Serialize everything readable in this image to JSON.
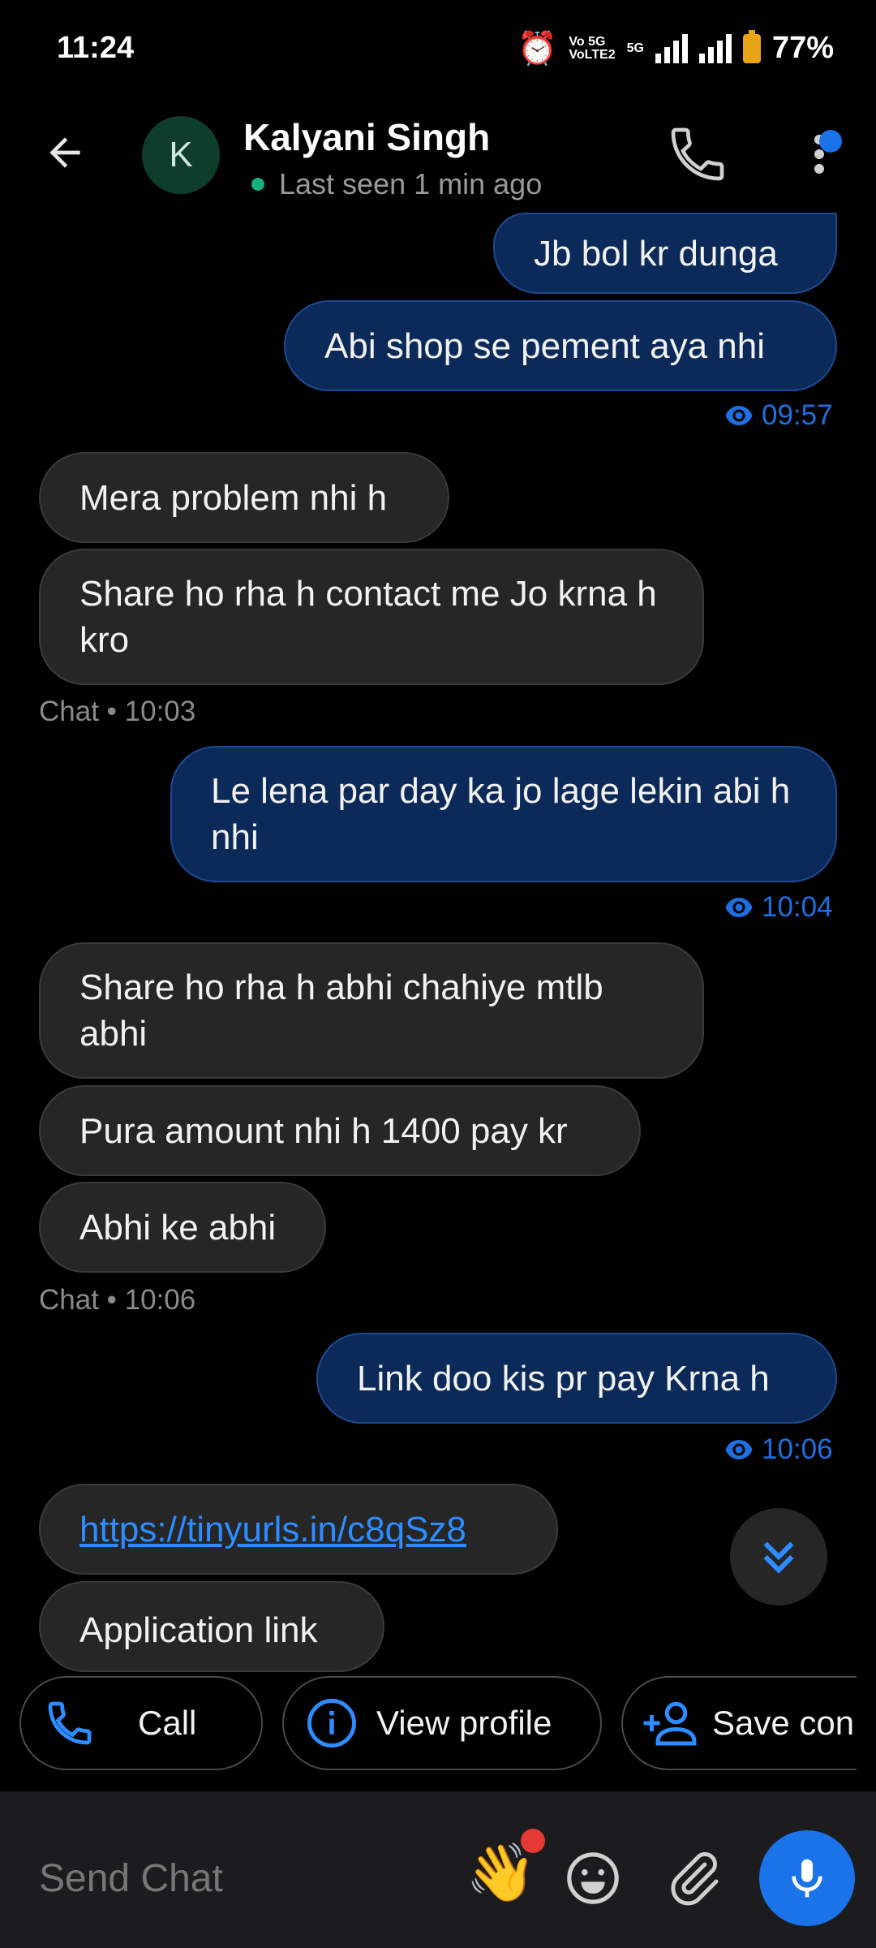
{
  "status_bar": {
    "time": "11:24",
    "net_top": "Vo 5G",
    "net_bottom": "VoLTE2",
    "net_5g": "5G",
    "battery": "77%"
  },
  "header": {
    "avatar_letter": "K",
    "name": "Kalyani Singh",
    "status": "Last seen 1 min ago"
  },
  "messages": [
    {
      "dir": "out",
      "text": "Jb bol kr dunga"
    },
    {
      "dir": "out",
      "text": "Abi shop se pement aya nhi"
    },
    {
      "seen_time": "09:57"
    },
    {
      "dir": "in",
      "text": "Mera problem nhi h"
    },
    {
      "dir": "in",
      "text": "Share ho rha h contact me Jo krna h kro"
    },
    {
      "meta": "Chat • 10:03"
    },
    {
      "dir": "out",
      "text": "Le lena par day ka jo lage lekin abi h nhi"
    },
    {
      "seen_time": "10:04"
    },
    {
      "dir": "in",
      "text": "Share ho rha h abhi chahiye mtlb abhi"
    },
    {
      "dir": "in",
      "text": "Pura amount nhi h 1400 pay kr"
    },
    {
      "dir": "in",
      "text": "Abhi ke abhi"
    },
    {
      "meta": "Chat • 10:06"
    },
    {
      "dir": "out",
      "text": "Link doo kis pr pay Krna h"
    },
    {
      "seen_time": "10:06"
    },
    {
      "dir": "in",
      "text": "https://tinyurls.in/c8qSz8"
    },
    {
      "dir": "in",
      "text": "Application link"
    }
  ],
  "chips": {
    "call": "Call",
    "view_profile": "View profile",
    "save_contact": "Save con"
  },
  "composer": {
    "placeholder": "Send Chat"
  },
  "colors": {
    "accent": "#1a73e8",
    "outgoing_bubble": "#0b2a5a",
    "incoming_bubble": "#262626",
    "online_dot": "#17b07a"
  }
}
